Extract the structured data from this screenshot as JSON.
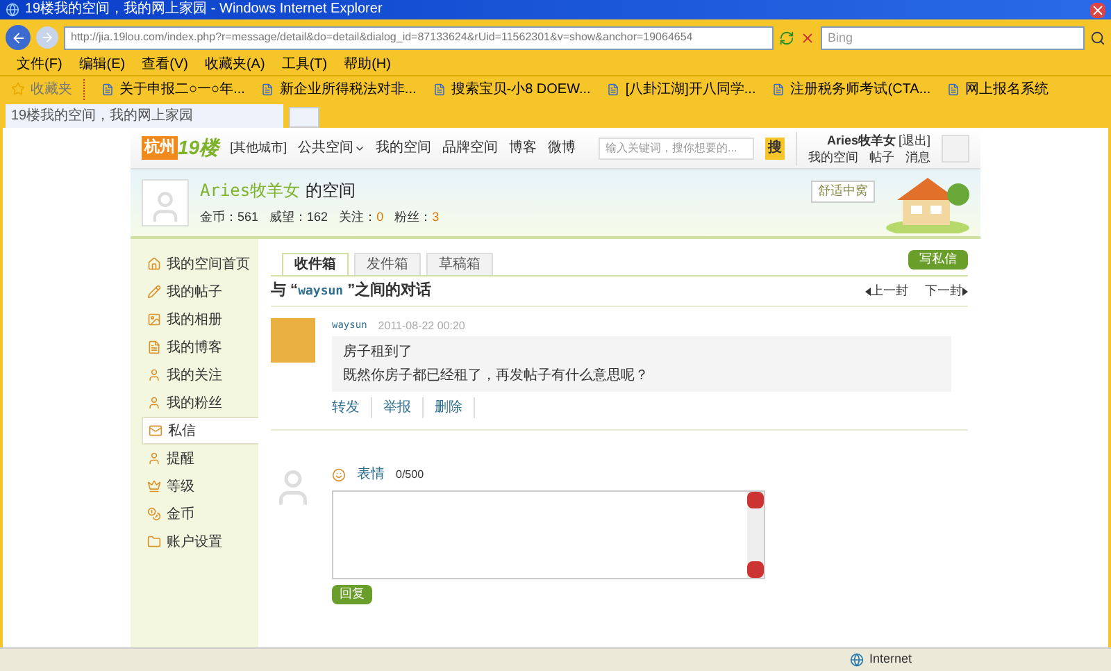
{
  "window": {
    "title": "19楼我的空间，我的网上家园 - Windows Internet Explorer"
  },
  "address_bar": {
    "url": "http://jia.19lou.com/index.php?r=message/detail&do=detail&dialog_id=87133624&rUid=11562301&v=show&anchor=19064654",
    "search_placeholder": "Bing"
  },
  "menu": [
    "文件(F)",
    "编辑(E)",
    "查看(V)",
    "收藏夹(A)",
    "工具(T)",
    "帮助(H)"
  ],
  "favorites": {
    "label": "收藏夹",
    "links": [
      "关于申报二○一○年...",
      "新企业所得税法对非...",
      "搜索宝贝-小8 DOEW...",
      "[八卦江湖]开八同学...",
      "注册税务师考试(CTA...",
      "网上报名系统"
    ]
  },
  "tabs": [
    {
      "label": "19楼我的空间，我的网上家园",
      "selected": true
    }
  ],
  "site_header": {
    "logo_city": "杭州",
    "logo_brand": "19楼",
    "city_switch": "[其他城市]",
    "nav": [
      {
        "label": "公共空间",
        "dropdown": true
      },
      {
        "label": "我的空间",
        "dropdown": false
      },
      {
        "label": "品牌空间",
        "dropdown": false
      },
      {
        "label": "博客",
        "dropdown": false
      },
      {
        "label": "微博",
        "dropdown": false
      }
    ],
    "search_placeholder": "输入关键词，搜你想要的...",
    "search_button": "搜",
    "user": "Aries牧羊女",
    "logout": "[退出]",
    "user_links": [
      "我的空间",
      "帖子",
      "消息"
    ]
  },
  "profile": {
    "name": "Aries牧羊女",
    "suffix": "的空间",
    "badge": "舒适中窝",
    "stats": [
      {
        "label": "金币：",
        "value": "561",
        "highlight": false
      },
      {
        "label": "威望：",
        "value": "162",
        "highlight": false
      },
      {
        "label": "关注：",
        "value": "0",
        "highlight": true
      },
      {
        "label": "粉丝：",
        "value": "3",
        "highlight": true
      }
    ]
  },
  "sidebar": [
    {
      "label": "我的空间首页",
      "selected": false
    },
    {
      "label": "我的帖子",
      "selected": false
    },
    {
      "label": "我的相册",
      "selected": false
    },
    {
      "label": "我的博客",
      "selected": false
    },
    {
      "label": "我的关注",
      "selected": false
    },
    {
      "label": "我的粉丝",
      "selected": false
    },
    {
      "label": "私信",
      "selected": true
    },
    {
      "label": "提醒",
      "selected": false
    },
    {
      "label": "等级",
      "selected": false
    },
    {
      "label": "金币",
      "selected": false
    },
    {
      "label": "账户设置",
      "selected": false
    }
  ],
  "mailbox_tabs": [
    {
      "label": "收件箱",
      "selected": true
    },
    {
      "label": "发件箱",
      "selected": false
    },
    {
      "label": "草稿箱",
      "selected": false
    }
  ],
  "write_button": "写私信",
  "conversation": {
    "prefix": "与 “",
    "user": "waysun",
    "suffix": " ”之间的对话",
    "prev": "上一封",
    "next": "下一封"
  },
  "message": {
    "author": "waysun",
    "time": "2011-08-22 00:20",
    "subject": "房子租到了",
    "body": "既然你房子都已经租了，再发帖子有什么意思呢？",
    "actions": [
      "转发",
      "举报",
      "删除"
    ]
  },
  "reply": {
    "emoji_label": "表情",
    "count": "0/500",
    "button": "回复"
  },
  "status_bar": {
    "zone": "Internet"
  }
}
